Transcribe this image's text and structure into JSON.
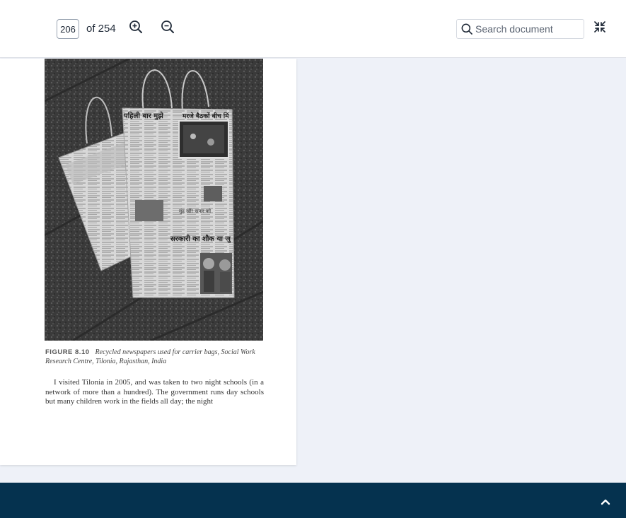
{
  "toolbar": {
    "page_current": "206",
    "page_total_label": "of 254",
    "zoom_in_icon": "zoom-in-icon",
    "zoom_out_icon": "zoom-out-icon",
    "search_placeholder": "Search document",
    "collapse_icon": "collapse-icon"
  },
  "document": {
    "figure_label": "FIGURE 8.10",
    "figure_caption": "Recycled newspapers used for carrier bags, Social Work Research Centre, Tilonia, Rajasthan, India",
    "body_text": "I visited Tilonia in 2005, and was taken to two night schools (in a network of more than a hundred). The government runs day schools but many children work in the fields all day; the night",
    "photo_text": {
      "headline_left": "पहिली बार मुझे",
      "headline_right": "मरजे बैठकों बीच मिं",
      "bag_headline": "सरकारी का शौक या जु",
      "bag_subline": "मुंह खीं! सफर को"
    }
  },
  "colors": {
    "toolbar_bg": "#ffffff",
    "viewer_bg": "#eef1f8",
    "footer_bg": "#05324f"
  },
  "footer": {
    "scroll_top_icon": "chevron-up-icon"
  }
}
